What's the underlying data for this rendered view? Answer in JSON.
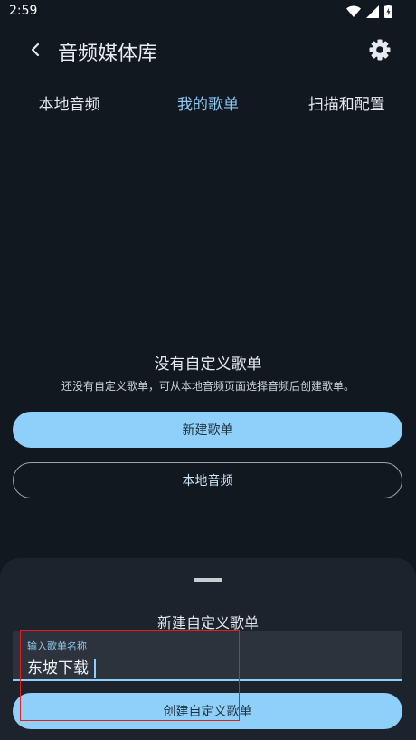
{
  "status_bar": {
    "time": "2:59",
    "icons": [
      "wifi-icon",
      "cell-signal-icon",
      "battery-icon"
    ]
  },
  "app_bar": {
    "title": "音频媒体库",
    "back_icon": "chevron-left-icon",
    "settings_icon": "gear-icon"
  },
  "tabs": [
    {
      "label": "本地音频",
      "active": false
    },
    {
      "label": "我的歌单",
      "active": true
    },
    {
      "label": "扫描和配置",
      "active": false
    }
  ],
  "empty_state": {
    "title": "没有自定义歌单",
    "description": "还没有自定义歌单，可从本地音频页面选择音频后创建歌单。",
    "primary_button": "新建歌单",
    "secondary_button": "本地音频"
  },
  "bottom_sheet": {
    "title": "新建自定义歌单",
    "input_label": "输入歌单名称",
    "input_value": "东坡下载",
    "submit_button": "创建自定义歌单"
  },
  "colors": {
    "background": "#121820",
    "accent": "#8fd0fb",
    "sheet": "#1c232d",
    "highlight": "#e02020"
  }
}
